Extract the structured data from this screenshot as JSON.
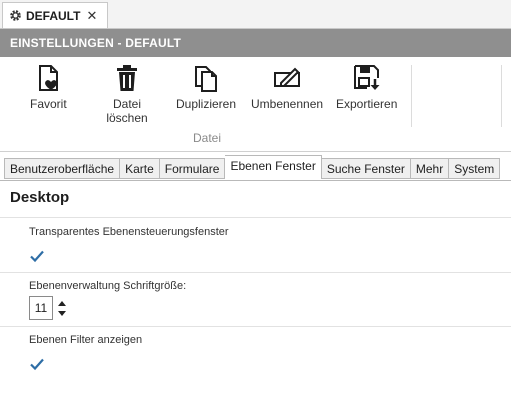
{
  "doc_tab": {
    "label": "DEFAULT",
    "close": "✕"
  },
  "titlebar": {
    "title": "EINSTELLUNGEN - DEFAULT"
  },
  "ribbon": {
    "buttons": [
      {
        "label": "Favorit",
        "icon": "favorite-file-icon"
      },
      {
        "label": "Datei\nlöschen",
        "icon": "trash-icon"
      },
      {
        "label": "Duplizieren",
        "icon": "duplicate-icon"
      },
      {
        "label": "Umbenennen",
        "icon": "rename-icon"
      },
      {
        "label": "Exportieren",
        "icon": "export-icon"
      }
    ],
    "group_label": "Datei"
  },
  "tabs": [
    {
      "label": "Benutzeroberfläche"
    },
    {
      "label": "Karte"
    },
    {
      "label": "Formulare"
    },
    {
      "label": "Ebenen Fenster",
      "active": true
    },
    {
      "label": "Suche Fenster"
    },
    {
      "label": "Mehr"
    },
    {
      "label": "System"
    }
  ],
  "content": {
    "section_title": "Desktop",
    "settings": [
      {
        "label": "Transparentes Ebenensteuerungsfenster",
        "checked": true
      },
      {
        "label": "Ebenenverwaltung Schriftgröße:",
        "value": "11"
      },
      {
        "label": "Ebenen Filter anzeigen",
        "checked": true
      }
    ]
  },
  "colors": {
    "titlebar": "#8f8f8f",
    "check": "#2e6ea6"
  }
}
